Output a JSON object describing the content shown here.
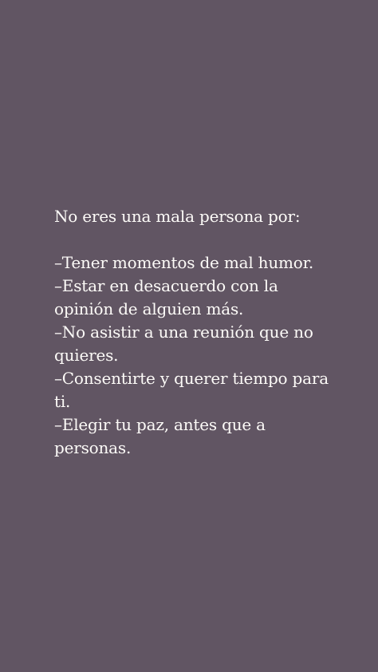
{
  "colors": {
    "background": "#615563",
    "text": "#fdfbf8"
  },
  "quote": {
    "intro": "No eres una mala persona por:",
    "items": [
      "–Tener momentos de mal humor.",
      "–Estar en desacuerdo con la opinión de alguien más.",
      "–No asistir a una reunión que no quieres.",
      "–Consentirte y querer tiempo para ti.",
      "–Elegir tu paz, antes que a personas."
    ]
  }
}
